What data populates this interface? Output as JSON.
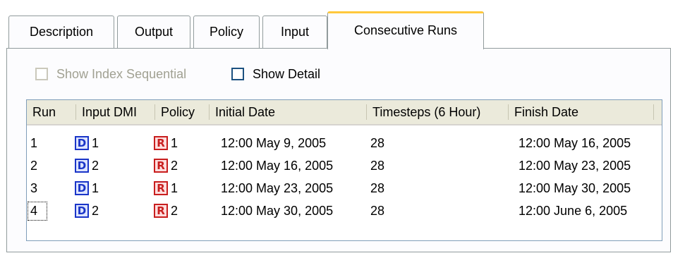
{
  "tabs": [
    {
      "label": "Description"
    },
    {
      "label": "Output"
    },
    {
      "label": "Policy"
    },
    {
      "label": "Input"
    },
    {
      "label": "Consecutive Runs",
      "active": true
    }
  ],
  "options": {
    "show_index_sequential": {
      "label": "Show Index Sequential",
      "checked": false,
      "enabled": false
    },
    "show_detail": {
      "label": "Show Detail",
      "checked": false,
      "enabled": true
    }
  },
  "table": {
    "columns": [
      "Run",
      "Input DMI",
      "Policy",
      "Initial Date",
      "Timesteps (6 Hour)",
      "Finish Date"
    ],
    "rows": [
      {
        "run": "1",
        "dmi_icon": "D",
        "dmi": "1",
        "policy_icon": "R",
        "policy": "1",
        "initial": "12:00 May 9, 2005",
        "timesteps": "28",
        "finish": "12:00 May 16, 2005"
      },
      {
        "run": "2",
        "dmi_icon": "D",
        "dmi": "2",
        "policy_icon": "R",
        "policy": "2",
        "initial": "12:00 May 16, 2005",
        "timesteps": "28",
        "finish": "12:00 May 23, 2005"
      },
      {
        "run": "3",
        "dmi_icon": "D",
        "dmi": "1",
        "policy_icon": "R",
        "policy": "1",
        "initial": "12:00 May 23, 2005",
        "timesteps": "28",
        "finish": "12:00 May 30, 2005"
      },
      {
        "run": "4",
        "dmi_icon": "D",
        "dmi": "2",
        "policy_icon": "R",
        "policy": "2",
        "initial": "12:00 May 30, 2005",
        "timesteps": "28",
        "finish": "12:00 June 6, 2005"
      }
    ]
  },
  "colors": {
    "active_tab_accent": "#ffc83c",
    "dmi_icon": "#1a35c8",
    "policy_icon": "#c81e1e"
  }
}
